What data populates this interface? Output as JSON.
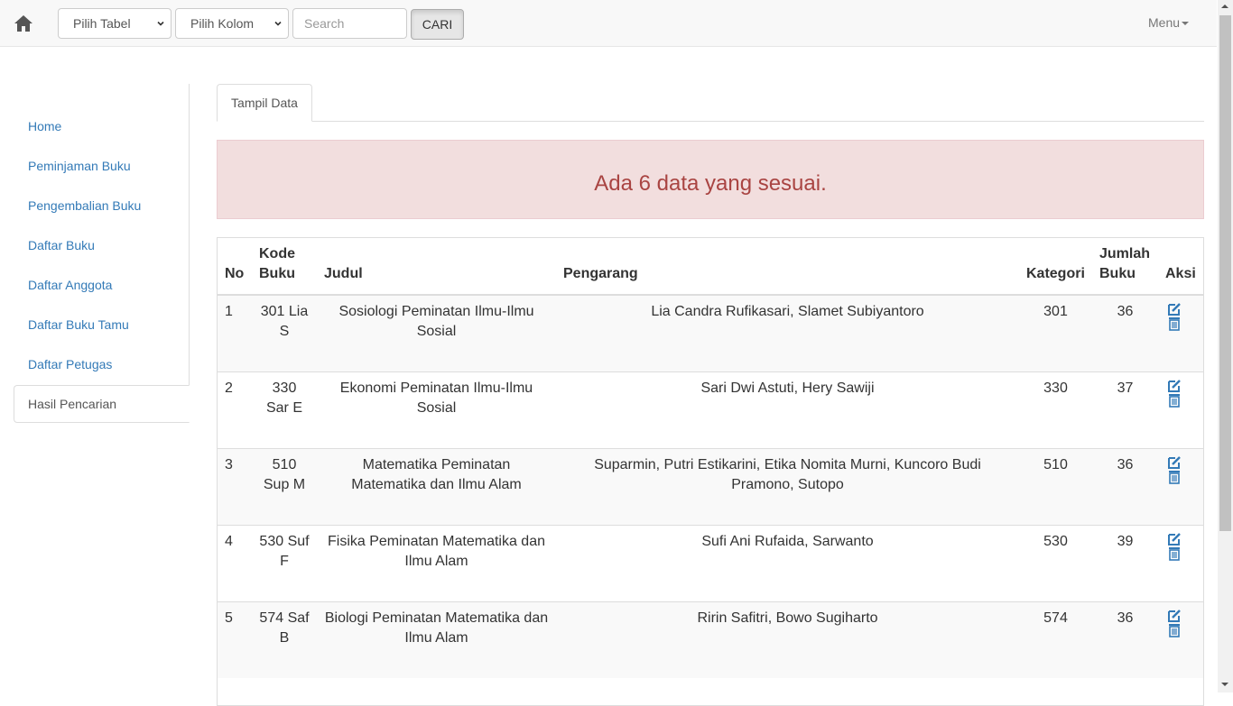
{
  "navbar": {
    "select_tabel": "Pilih Tabel",
    "select_kolom": "Pilih Kolom",
    "search_placeholder": "Search",
    "search_button": "CARI",
    "menu_label": "Menu"
  },
  "sidebar": {
    "items": [
      {
        "label": "Home"
      },
      {
        "label": "Peminjaman Buku"
      },
      {
        "label": "Pengembalian Buku"
      },
      {
        "label": "Daftar Buku"
      },
      {
        "label": "Daftar Anggota"
      },
      {
        "label": "Daftar Buku Tamu"
      },
      {
        "label": "Daftar Petugas"
      },
      {
        "label": "Hasil Pencarian"
      }
    ]
  },
  "tabs": [
    {
      "label": "Tampil Data"
    }
  ],
  "alert": {
    "text": "Ada 6 data yang sesuai."
  },
  "table": {
    "headers": {
      "no": "No",
      "kode_1": "Kode",
      "kode_2": "Buku",
      "judul": "Judul",
      "pengarang": "Pengarang",
      "kategori": "Kategori",
      "jumlah_1": "Jumlah",
      "jumlah_2": "Buku",
      "aksi": "Aksi"
    },
    "rows": [
      {
        "no": "1",
        "kode": "301 Lia S",
        "judul": "Sosiologi Peminatan Ilmu-Ilmu Sosial",
        "pengarang": "Lia Candra Rufikasari, Slamet Subiyantoro",
        "kategori": "301",
        "jumlah": "36"
      },
      {
        "no": "2",
        "kode": "330 Sar E",
        "judul": "Ekonomi Peminatan Ilmu-Ilmu Sosial",
        "pengarang": "Sari Dwi Astuti, Hery Sawiji",
        "kategori": "330",
        "jumlah": "37"
      },
      {
        "no": "3",
        "kode": "510 Sup M",
        "judul": "Matematika Peminatan Matematika dan Ilmu Alam",
        "pengarang": "Suparmin, Putri Estikarini, Etika Nomita Murni, Kuncoro Budi Pramono, Sutopo",
        "kategori": "510",
        "jumlah": "36"
      },
      {
        "no": "4",
        "kode": "530 Suf F",
        "judul": "Fisika Peminatan Matematika dan Ilmu Alam",
        "pengarang": "Sufi Ani Rufaida, Sarwanto",
        "kategori": "530",
        "jumlah": "39"
      },
      {
        "no": "5",
        "kode": "574 Saf B",
        "judul": "Biologi Peminatan Matematika dan Ilmu Alam",
        "pengarang": "Ririn Safitri, Bowo Sugiharto",
        "kategori": "574",
        "jumlah": "36"
      }
    ]
  },
  "colors": {
    "link": "#337ab7",
    "alert_bg": "#f2dede",
    "alert_text": "#a94442"
  },
  "icons": {
    "home": "home-icon",
    "edit": "edit-icon",
    "delete": "trash-icon"
  }
}
